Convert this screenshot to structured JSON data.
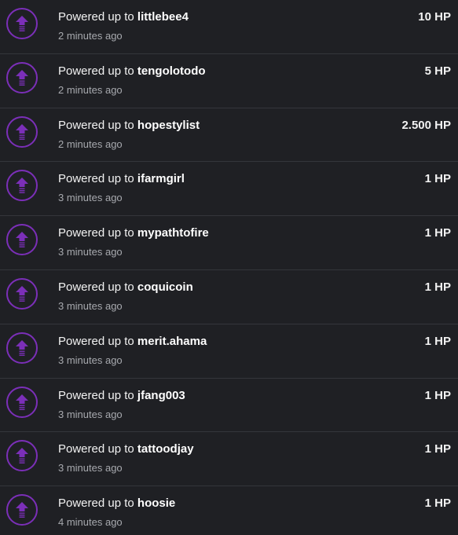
{
  "accent_color": "#7b2fb8",
  "icon_name": "power-up-arrow-icon",
  "items": [
    {
      "prefix": "Powered up to ",
      "user": "littlebee4",
      "time": "2 minutes ago",
      "amount": "10 HP"
    },
    {
      "prefix": "Powered up to ",
      "user": "tengolotodo",
      "time": "2 minutes ago",
      "amount": "5 HP"
    },
    {
      "prefix": "Powered up to ",
      "user": "hopestylist",
      "time": "2 minutes ago",
      "amount": "2.500 HP"
    },
    {
      "prefix": "Powered up to ",
      "user": "ifarmgirl",
      "time": "3 minutes ago",
      "amount": "1 HP"
    },
    {
      "prefix": "Powered up to ",
      "user": "mypathtofire",
      "time": "3 minutes ago",
      "amount": "1 HP"
    },
    {
      "prefix": "Powered up to ",
      "user": "coquicoin",
      "time": "3 minutes ago",
      "amount": "1 HP"
    },
    {
      "prefix": "Powered up to ",
      "user": "merit.ahama",
      "time": "3 minutes ago",
      "amount": "1 HP"
    },
    {
      "prefix": "Powered up to ",
      "user": "jfang003",
      "time": "3 minutes ago",
      "amount": "1 HP"
    },
    {
      "prefix": "Powered up to ",
      "user": "tattoodjay",
      "time": "3 minutes ago",
      "amount": "1 HP"
    },
    {
      "prefix": "Powered up to ",
      "user": "hoosie",
      "time": "4 minutes ago",
      "amount": "1 HP"
    }
  ]
}
